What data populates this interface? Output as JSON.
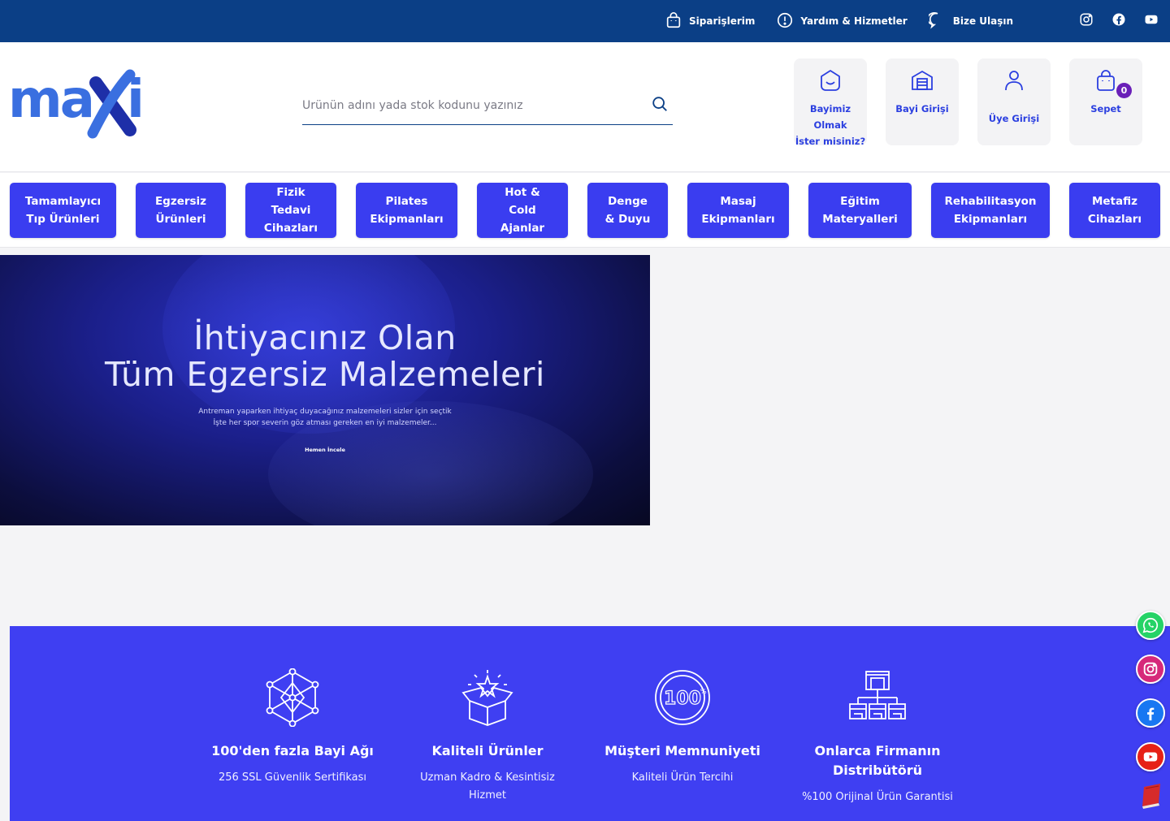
{
  "topbar": {
    "links": [
      {
        "label": "Siparişlerim",
        "icon": "shopping-bag-icon"
      },
      {
        "label": "Yardım & Hizmetler",
        "icon": "alert-circle-icon"
      },
      {
        "label": "Bize Ulaşın",
        "icon": "chat-bubble-icon"
      }
    ],
    "social": [
      "instagram-icon",
      "facebook-icon",
      "youtube-icon"
    ]
  },
  "header": {
    "logo_text": "maxi",
    "search": {
      "placeholder": "Ürünün adını yada stok kodunu yazınız",
      "value": ""
    },
    "buttons": [
      {
        "label": "Bayimiz Olmak\nİster misiniz?",
        "icon": "smile-bag-icon"
      },
      {
        "label": "Bayi Girişi",
        "icon": "store-icon"
      },
      {
        "label": "Üye Girişi",
        "icon": "user-icon"
      },
      {
        "label": "Sepet",
        "icon": "cart-bag-icon",
        "badge": "0"
      }
    ]
  },
  "categories": [
    "Tamamlayıcı\nTıp Ürünleri",
    "Egzersiz\nÜrünleri",
    "Fizik\nTedavi\nCihazları",
    "Pilates\nEkipmanları",
    "Hot &\nCold\nAjanlar",
    "Denge\n& Duyu",
    "Masaj\nEkipmanları",
    "Eğitim\nMateryalleri",
    "Rehabilitasyon\nEkipmanları",
    "Metafiz\nCihazları"
  ],
  "hero": {
    "title": "İhtiyacınız Olan\nTüm Egzersiz Malzemeleri",
    "subtitle": "Antreman yaparken ihtiyaç duyacağınız malzemeleri sizler için seçtik\nİşte her spor severin göz atması gereken en iyi malzemeler...",
    "link": "Hemen İncele"
  },
  "features": [
    {
      "title": "100'den fazla Bayi Ağı",
      "subtitle": "256 SSL Güvenlik Sertifikası",
      "icon": "network-icon"
    },
    {
      "title": "Kaliteli Ürünler",
      "subtitle": "Uzman Kadro & Kesintisiz\nHizmet",
      "icon": "open-box-star-icon"
    },
    {
      "title": "Müşteri Memnuniyeti",
      "subtitle": "Kaliteli Ürün Tercihi",
      "icon": "hundred-percent-icon"
    },
    {
      "title": "Onlarca Firmanın\nDistribütörü",
      "subtitle": "%100 Orijinal Ürün Garantisi",
      "icon": "distribution-tree-icon"
    }
  ],
  "floating_social": [
    "whatsapp-icon",
    "instagram-icon",
    "facebook-icon",
    "youtube-icon",
    "book-icon"
  ],
  "colors": {
    "topbar": "#0b3f86",
    "accent": "#3a3df0",
    "features_bg": "#3f3ff2",
    "badge": "#6a1fb8"
  }
}
